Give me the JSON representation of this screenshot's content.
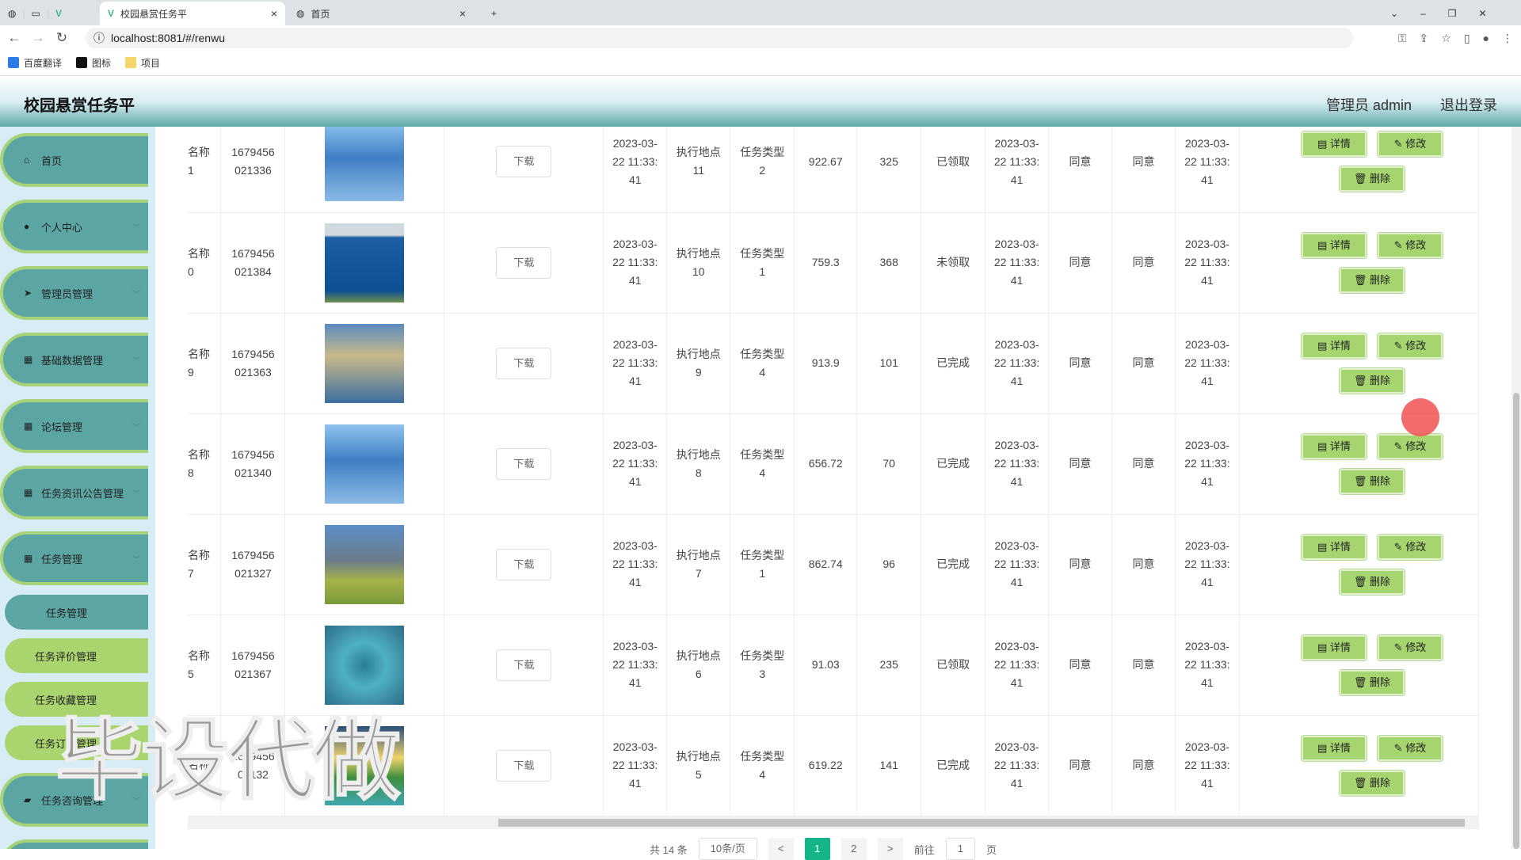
{
  "browser": {
    "tabs": [
      {
        "label": "校园悬赏任务平",
        "active": true
      },
      {
        "label": "首页",
        "active": false
      }
    ],
    "url": "localhost:8081/#/renwu",
    "bookmarks": [
      "百度翻译",
      "图标",
      "项目"
    ]
  },
  "header": {
    "title": "校园悬赏任务平",
    "user": "管理员 admin",
    "logout": "退出登录"
  },
  "sidebar": {
    "menus": [
      {
        "label": "首页",
        "icon": "home-icon"
      },
      {
        "label": "个人中心",
        "icon": "user-icon"
      },
      {
        "label": "管理员管理",
        "icon": "send-icon"
      },
      {
        "label": "基础数据管理",
        "icon": "grid-icon"
      },
      {
        "label": "论坛管理",
        "icon": "grid-icon"
      },
      {
        "label": "任务资讯公告管理",
        "icon": "grid-icon"
      },
      {
        "label": "任务管理",
        "icon": "grid-icon"
      }
    ],
    "submenu": [
      {
        "label": "任务管理",
        "active": true
      },
      {
        "label": "任务评价管理"
      },
      {
        "label": "任务收藏管理"
      },
      {
        "label": "任务订单管理"
      }
    ],
    "after": [
      {
        "label": "任务咨询管理",
        "icon": "wallet-icon"
      }
    ]
  },
  "table": {
    "download": "下载",
    "detail": "详情",
    "edit": "修改",
    "delete": "删除",
    "rows": [
      {
        "name": "名称 1",
        "id": "1679456021336",
        "date": "2023-03-22 11:33:41",
        "place": "执行地点 11",
        "type": "任务类型 2",
        "price": "922.67",
        "count": "325",
        "status": "已领取",
        "date2": "2023-03-22 11:33:41",
        "a1": "同意",
        "a2": "同意",
        "date3": "2023-03-22 11:33:41"
      },
      {
        "name": "名称 0",
        "id": "1679456021384",
        "date": "2023-03-22 11:33:41",
        "place": "执行地点 10",
        "type": "任务类型 1",
        "price": "759.3",
        "count": "368",
        "status": "未领取",
        "date2": "2023-03-22 11:33:41",
        "a1": "同意",
        "a2": "同意",
        "date3": "2023-03-22 11:33:41"
      },
      {
        "name": "名称 9",
        "id": "1679456021363",
        "date": "2023-03-22 11:33:41",
        "place": "执行地点 9",
        "type": "任务类型 4",
        "price": "913.9",
        "count": "101",
        "status": "已完成",
        "date2": "2023-03-22 11:33:41",
        "a1": "同意",
        "a2": "同意",
        "date3": "2023-03-22 11:33:41"
      },
      {
        "name": "名称 8",
        "id": "1679456021340",
        "date": "2023-03-22 11:33:41",
        "place": "执行地点 8",
        "type": "任务类型 4",
        "price": "656.72",
        "count": "70",
        "status": "已完成",
        "date2": "2023-03-22 11:33:41",
        "a1": "同意",
        "a2": "同意",
        "date3": "2023-03-22 11:33:41"
      },
      {
        "name": "名称 7",
        "id": "1679456021327",
        "date": "2023-03-22 11:33:41",
        "place": "执行地点 7",
        "type": "任务类型 1",
        "price": "862.74",
        "count": "96",
        "status": "已完成",
        "date2": "2023-03-22 11:33:41",
        "a1": "同意",
        "a2": "同意",
        "date3": "2023-03-22 11:33:41"
      },
      {
        "name": "名称 5",
        "id": "1679456021367",
        "date": "2023-03-22 11:33:41",
        "place": "执行地点 6",
        "type": "任务类型 3",
        "price": "91.03",
        "count": "235",
        "status": "已领取",
        "date2": "2023-03-22 11:33:41",
        "a1": "同意",
        "a2": "同意",
        "date3": "2023-03-22 11:33:41"
      },
      {
        "name": "名称",
        "id": "167945602132",
        "date": "2023-03-22 11:33:41",
        "place": "执行地点 5",
        "type": "任务类型 4",
        "price": "619.22",
        "count": "141",
        "status": "已完成",
        "date2": "2023-03-22 11:33:41",
        "a1": "同意",
        "a2": "同意",
        "date3": "2023-03-22 11:33:41"
      }
    ]
  },
  "pagination": {
    "total": "共 14 条",
    "size": "10条/页",
    "prev": "<",
    "pages": [
      "1",
      "2"
    ],
    "next": ">",
    "goto": "前往",
    "page": "1",
    "page_unit": "页"
  },
  "watermark": "毕设代做"
}
